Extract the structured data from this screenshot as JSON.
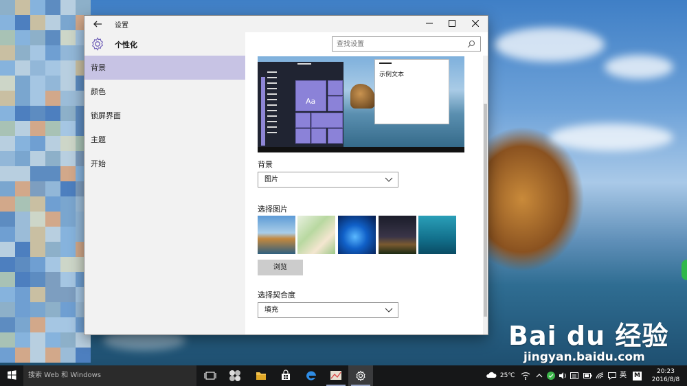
{
  "window": {
    "title": "设置",
    "section_title": "个性化",
    "search_placeholder": "查找设置"
  },
  "sidebar": {
    "items": [
      {
        "label": "背景",
        "active": true
      },
      {
        "label": "颜色"
      },
      {
        "label": "锁屏界面"
      },
      {
        "label": "主题"
      },
      {
        "label": "开始"
      }
    ]
  },
  "content": {
    "preview_sample_text": "示例文本",
    "preview_tile_text": "Aa",
    "background_label": "背景",
    "background_value": "图片",
    "choose_picture_label": "选择图片",
    "browse_label": "浏览",
    "fit_label": "选择契合度",
    "fit_value": "填充"
  },
  "taskbar": {
    "search_placeholder": "搜索 Web 和 Windows",
    "temperature": "25℃",
    "ime_lang": "英",
    "ime_mode": "M",
    "time": "20:23",
    "date": "2016/8/8"
  },
  "watermark": {
    "logo_text": "Bai du 经验",
    "url": "jingyan.baidu.com"
  },
  "colors": {
    "accent": "#8b82d8",
    "sidebar_active": "#c7c3e4",
    "taskbar": "#161718"
  }
}
